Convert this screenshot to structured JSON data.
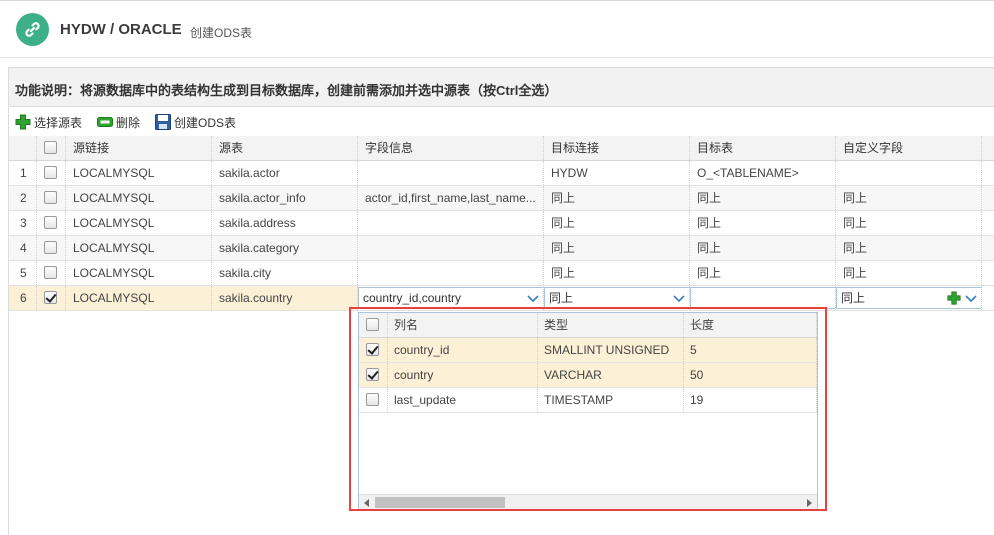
{
  "header": {
    "title": "HYDW / ORACLE",
    "subtitle": "创建ODS表",
    "logo_icon": "link-icon",
    "accent": "#3db08a"
  },
  "description": "功能说明：将源数据库中的表结构生成到目标数据库，创建前需添加并选中源表（按Ctrl全选）",
  "toolbar": {
    "select_source": "选择源表",
    "delete": "删除",
    "create_ods": "创建ODS表"
  },
  "grid": {
    "columns": [
      "源链接",
      "源表",
      "字段信息",
      "目标连接",
      "目标表",
      "自定义字段"
    ],
    "rows": [
      {
        "num": "1",
        "checked": false,
        "source_link": "LOCALMYSQL",
        "source_table": "sakila.actor",
        "fields": "",
        "target_conn": "HYDW",
        "target_table": "O_<TABLENAME>",
        "custom": ""
      },
      {
        "num": "2",
        "checked": false,
        "source_link": "LOCALMYSQL",
        "source_table": "sakila.actor_info",
        "fields": "actor_id,first_name,last_name...",
        "target_conn": "同上",
        "target_table": "同上",
        "custom": "同上"
      },
      {
        "num": "3",
        "checked": false,
        "source_link": "LOCALMYSQL",
        "source_table": "sakila.address",
        "fields": "",
        "target_conn": "同上",
        "target_table": "同上",
        "custom": "同上"
      },
      {
        "num": "4",
        "checked": false,
        "source_link": "LOCALMYSQL",
        "source_table": "sakila.category",
        "fields": "",
        "target_conn": "同上",
        "target_table": "同上",
        "custom": "同上"
      },
      {
        "num": "5",
        "checked": false,
        "source_link": "LOCALMYSQL",
        "source_table": "sakila.city",
        "fields": "",
        "target_conn": "同上",
        "target_table": "同上",
        "custom": "同上"
      },
      {
        "num": "6",
        "checked": true,
        "source_link": "LOCALMYSQL",
        "source_table": "sakila.country",
        "fields": "country_id,country",
        "target_conn": "同上",
        "target_table": "",
        "custom": "同上"
      }
    ]
  },
  "dropdown": {
    "columns": [
      "列名",
      "类型",
      "长度"
    ],
    "rows": [
      {
        "checked": true,
        "name": "country_id",
        "type": "SMALLINT UNSIGNED",
        "length": "5"
      },
      {
        "checked": true,
        "name": "country",
        "type": "VARCHAR",
        "length": "50"
      },
      {
        "checked": false,
        "name": "last_update",
        "type": "TIMESTAMP",
        "length": "19"
      }
    ]
  }
}
